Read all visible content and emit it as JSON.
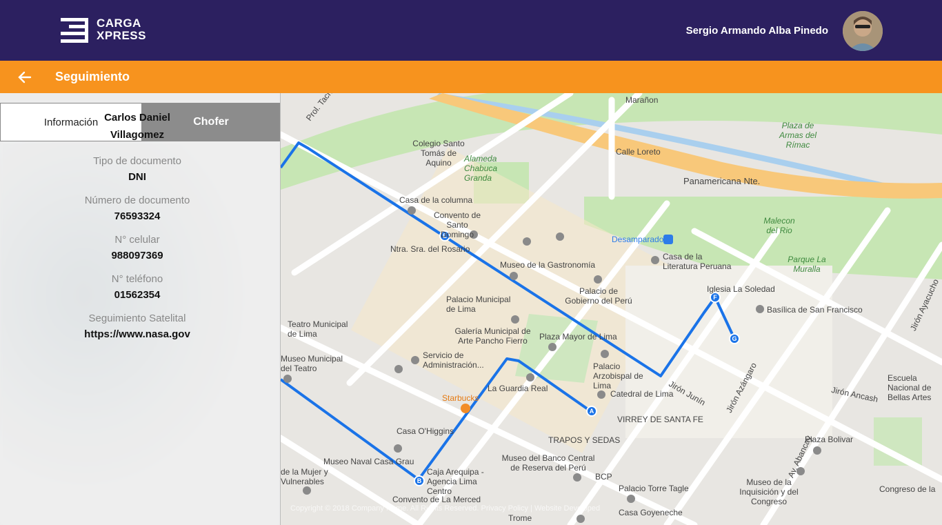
{
  "header": {
    "logo_line1": "CARGA",
    "logo_line2": "XPRESS",
    "user_name": "Sergio Armando Alba Pinedo"
  },
  "subheader": {
    "title": "Seguimiento"
  },
  "tabs": [
    {
      "label": "Información",
      "active": true
    },
    {
      "label": "Chofer",
      "active": false
    }
  ],
  "driver": {
    "name_line1": "Carlos Daniel",
    "name_line2": "Villagomez",
    "doc_type_label": "Tipo de documento",
    "doc_type": "DNI",
    "doc_number_label": "Número de documento",
    "doc_number": "76593324",
    "cell_label": "N° celular",
    "cell": "988097369",
    "phone_label": "N° teléfono",
    "phone": "01562354",
    "satellite_label": "Seguimiento Satelital",
    "satellite_url": "https://www.nasa.gov"
  },
  "map": {
    "markers": [
      "A",
      "B",
      "E",
      "F",
      "G"
    ],
    "labels": [
      {
        "t": "Prol. Tacna"
      },
      {
        "t": "Colegio Santo Tomás de Aquino"
      },
      {
        "t": "Alameda Chabuca Granda"
      },
      {
        "t": "Panamericana Nte."
      },
      {
        "t": "Marañon"
      },
      {
        "t": "Plaza de Armas del Rímac"
      },
      {
        "t": "Calle Loreto"
      },
      {
        "t": "Casa de la columna"
      },
      {
        "t": "Convento de Santo Domingo"
      },
      {
        "t": "Ntra. Sra. del Rosario"
      },
      {
        "t": "Museo de la Gastronomía"
      },
      {
        "t": "Palacio de Gobierno del Perú"
      },
      {
        "t": "Desamparados"
      },
      {
        "t": "Malecon del Rio"
      },
      {
        "t": "Casa de la Literatura Peruana"
      },
      {
        "t": "Parque La Muralla"
      },
      {
        "t": "Iglesia La Soledad"
      },
      {
        "t": "Basílica de San Francisco"
      },
      {
        "t": "Palacio Municipal de Lima"
      },
      {
        "t": "Galería Municipal de Arte Pancho Fierro"
      },
      {
        "t": "Plaza Mayor de Lima"
      },
      {
        "t": "Palacio Arzobispal de Lima"
      },
      {
        "t": "Catedral de Lima"
      },
      {
        "t": "Teatro Municipal de Lima"
      },
      {
        "t": "Museo Municipal del Teatro"
      },
      {
        "t": "Servicio de Administración..."
      },
      {
        "t": "La Guardia Real"
      },
      {
        "t": "Starbucks"
      },
      {
        "t": "VIRREY DE SANTA FE"
      },
      {
        "t": "TRAPOS Y SEDAS"
      },
      {
        "t": "Casa O'Higgins"
      },
      {
        "t": "Museo Naval Casa Grau"
      },
      {
        "t": "Caja Arequipa - Agencia Lima Centro"
      },
      {
        "t": "Museo del Banco Central de Reserva del Perú"
      },
      {
        "t": "BCP"
      },
      {
        "t": "Palacio Torre Tagle"
      },
      {
        "t": "Casa Goyeneche"
      },
      {
        "t": "Plaza Bolivar"
      },
      {
        "t": "Museo de la Inquisición y del Congreso"
      },
      {
        "t": "Congreso de la"
      },
      {
        "t": "Escuela Nacional de Bellas Artes"
      },
      {
        "t": "Jirón Ancash"
      },
      {
        "t": "Jirón Junín"
      },
      {
        "t": "Jirón Azángaro"
      },
      {
        "t": "Av. Abancay"
      },
      {
        "t": "Jirón Ayacucho"
      },
      {
        "t": "Convento de La Merced"
      },
      {
        "t": "Trome"
      },
      {
        "t": "de la Mujer y Vulnerables"
      }
    ],
    "copyright": "Copyright © 2018 Company Name. All Rights Reserved. Privacy Policy | Website Developed"
  }
}
